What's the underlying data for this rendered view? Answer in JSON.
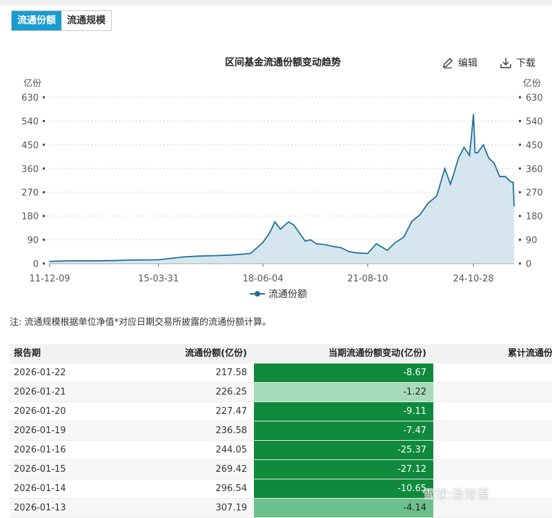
{
  "tabs": [
    {
      "label": "流通份额",
      "active": true
    },
    {
      "label": "流通规模",
      "active": false
    }
  ],
  "toolbar": {
    "edit_label": "编辑",
    "download_label": "下载"
  },
  "note": "注:   流通规模根据单位净值*对应日期交易所披露的流通份额计算。",
  "watermark": "雪球:汤诗语",
  "chart_data": {
    "type": "area",
    "title": "区间基金流通份额变动趋势",
    "unit_left": "亿份",
    "unit_right": "亿份",
    "ylim": [
      0,
      630
    ],
    "yticks": [
      0,
      90,
      180,
      270,
      360,
      450,
      540,
      630
    ],
    "x_tick_labels": [
      "11-12-09",
      "15-03-31",
      "18-06-04",
      "21-08-10",
      "24-10-28"
    ],
    "grid": true,
    "legend_position": "bottom",
    "series": [
      {
        "name": "流通份额",
        "color": "#1f6f99",
        "fill": "#d6e6ef",
        "x": [
          "2011-12-09",
          "2012-06",
          "2013-06",
          "2014-06",
          "2015-03-31",
          "2016-01",
          "2016-06",
          "2017-01",
          "2017-06",
          "2018-01",
          "2018-03",
          "2018-06-04",
          "2018-08",
          "2018-10",
          "2018-12",
          "2019-03",
          "2019-05",
          "2019-07",
          "2019-09",
          "2019-11",
          "2020-01",
          "2020-04",
          "2020-07",
          "2020-10",
          "2021-01",
          "2021-04",
          "2021-08-10",
          "2021-11",
          "2022-03",
          "2022-06",
          "2022-09",
          "2022-12",
          "2023-03",
          "2023-06",
          "2023-09",
          "2023-12",
          "2024-02",
          "2024-03",
          "2024-05",
          "2024-07",
          "2024-09",
          "2024-10-28",
          "2024-11",
          "2024-12",
          "2025-02",
          "2025-04",
          "2025-06",
          "2025-08",
          "2025-10",
          "2025-12",
          "2026-01-13",
          "2026-01-22"
        ],
        "values": [
          8,
          10,
          10,
          13,
          14,
          25,
          28,
          30,
          32,
          38,
          55,
          80,
          115,
          158,
          130,
          158,
          145,
          115,
          85,
          90,
          75,
          72,
          65,
          60,
          45,
          40,
          38,
          75,
          50,
          80,
          100,
          160,
          185,
          230,
          255,
          360,
          300,
          330,
          400,
          440,
          410,
          565,
          420,
          420,
          450,
          400,
          380,
          330,
          330,
          310,
          307,
          218
        ]
      }
    ]
  },
  "table": {
    "headers": [
      "报告期",
      "流通份额(亿份)",
      "当期流通份额变动(亿份)",
      "累计流通份额"
    ],
    "rows": [
      {
        "date": "2026-01-22",
        "share": "217.58",
        "change": "-8.67",
        "color": "#0f8a3c"
      },
      {
        "date": "2026-01-21",
        "share": "226.25",
        "change": "-1.22",
        "color": "#a7dbb8"
      },
      {
        "date": "2026-01-20",
        "share": "227.47",
        "change": "-9.11",
        "color": "#0f8a3c"
      },
      {
        "date": "2026-01-19",
        "share": "236.58",
        "change": "-7.47",
        "color": "#0f8a3c"
      },
      {
        "date": "2026-01-16",
        "share": "244.05",
        "change": "-25.37",
        "color": "#0f8a3c"
      },
      {
        "date": "2026-01-15",
        "share": "269.42",
        "change": "-27.12",
        "color": "#0f8a3c"
      },
      {
        "date": "2026-01-14",
        "share": "296.54",
        "change": "-10.65",
        "color": "#0f8a3c"
      },
      {
        "date": "2026-01-13",
        "share": "307.19",
        "change": "-4.14",
        "color": "#6cc28c"
      }
    ]
  }
}
